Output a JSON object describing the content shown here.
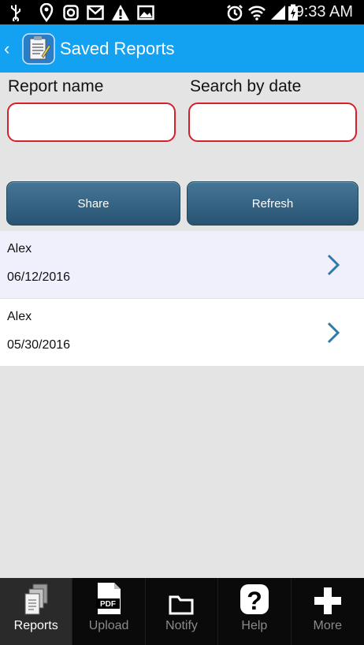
{
  "status_bar": {
    "time": "9:33 AM",
    "icons": [
      "usb-icon",
      "location-icon",
      "instagram-icon",
      "gmail-icon",
      "warning-icon",
      "gallery-icon",
      "alarm-icon",
      "wifi-icon",
      "signal-icon",
      "battery-icon"
    ]
  },
  "header": {
    "title": "Saved Reports",
    "back_glyph": "‹",
    "accent_color": "#13a1f1"
  },
  "filters": {
    "report_name_label": "Report name",
    "report_name_value": "",
    "search_by_date_label": "Search by date",
    "search_by_date_value": ""
  },
  "actions": {
    "share_label": "Share",
    "refresh_label": "Refresh"
  },
  "reports": [
    {
      "name": "Alex",
      "date": "06/12/2016"
    },
    {
      "name": "Alex",
      "date": "05/30/2016"
    }
  ],
  "bottom_nav": [
    {
      "label": "Reports",
      "icon": "reports-icon",
      "active": true
    },
    {
      "label": "Upload",
      "icon": "pdf-icon",
      "active": false
    },
    {
      "label": "Notify",
      "icon": "folder-icon",
      "active": false
    },
    {
      "label": "Help",
      "icon": "help-icon",
      "active": false
    },
    {
      "label": "More",
      "icon": "plus-icon",
      "active": false
    }
  ]
}
